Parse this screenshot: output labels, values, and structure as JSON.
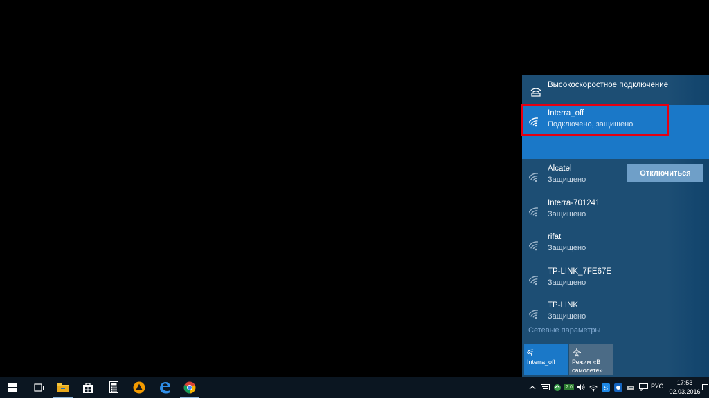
{
  "flyout": {
    "broadband": {
      "name": "Высокоскоростное подключение",
      "icon": "broadband-icon"
    },
    "connected": {
      "name": "Interra_off",
      "status": "Подключено, защищено",
      "disconnect_label": "Отключиться",
      "icon": "wifi-icon"
    },
    "networks": [
      {
        "name": "Alcatel",
        "status": "Защищено",
        "icon": "wifi-icon"
      },
      {
        "name": "Interra-701241",
        "status": "Защищено",
        "icon": "wifi-icon"
      },
      {
        "name": "rifat",
        "status": "Защищено",
        "icon": "wifi-icon"
      },
      {
        "name": "TP-LINK_7FE67E",
        "status": "Защищено",
        "icon": "wifi-icon"
      },
      {
        "name": "TP-LINK",
        "status": "Защищено",
        "icon": "wifi-icon"
      }
    ],
    "network_settings": "Сетевые параметры",
    "tiles": {
      "wifi": {
        "label": "Interra_off",
        "icon": "wifi-icon"
      },
      "airplane": {
        "label": "Режим «В самолете»",
        "icon": "airplane-icon"
      }
    }
  },
  "taskbar": {
    "apps": [
      "start-icon",
      "task-view-icon",
      "file-explorer-icon",
      "store-icon",
      "calculator-icon",
      "aimp-icon",
      "edge-icon",
      "chrome-icon"
    ],
    "tray_badge": "2.0",
    "language": "РУС",
    "time": "17:53",
    "date": "02.03.2016"
  },
  "colors": {
    "flyout_bg": "#1d4e74",
    "accent": "#1a78c8",
    "highlight": "#e60012",
    "taskbar_bg": "#0b1621"
  }
}
